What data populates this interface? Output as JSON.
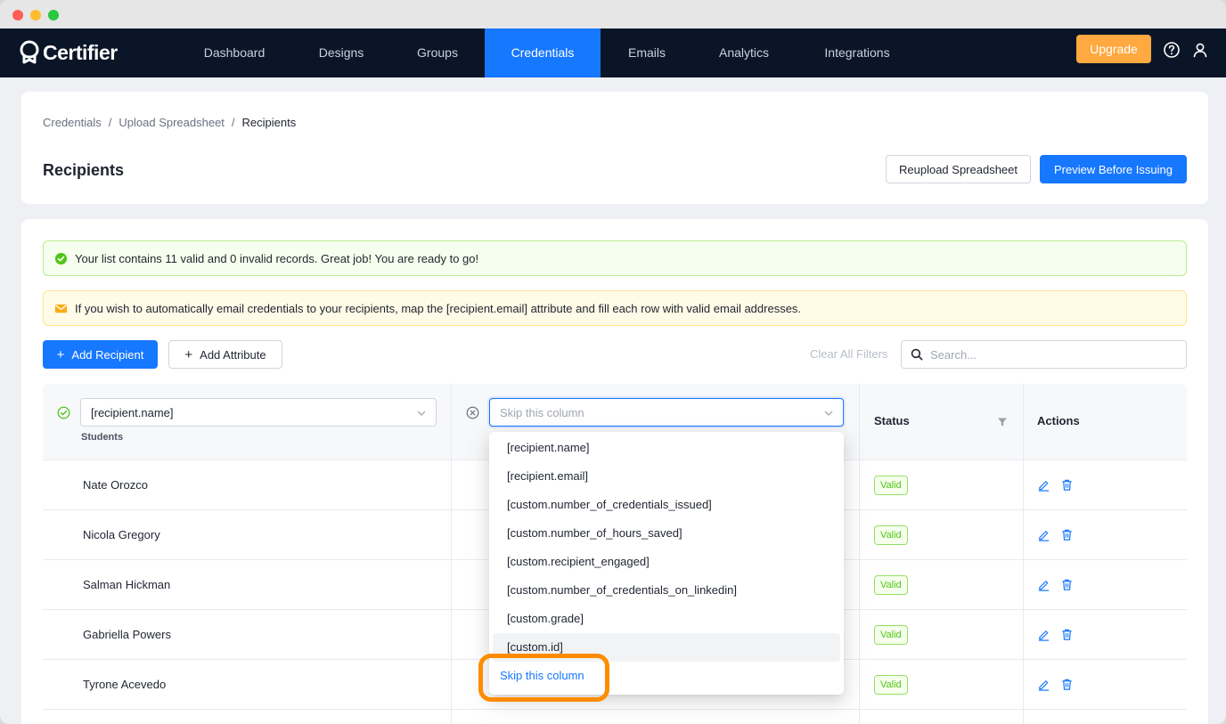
{
  "app": {
    "name": "Certifier",
    "nav": [
      {
        "label": "Dashboard"
      },
      {
        "label": "Designs"
      },
      {
        "label": "Groups"
      },
      {
        "label": "Credentials"
      },
      {
        "label": "Emails"
      },
      {
        "label": "Analytics"
      },
      {
        "label": "Integrations"
      }
    ],
    "active_nav": "Credentials",
    "upgrade_label": "Upgrade"
  },
  "header": {
    "breadcrumb": [
      "Credentials",
      "/",
      "Upload Spreadsheet",
      "/",
      "Recipients"
    ],
    "title": "Recipients",
    "reupload_label": "Reupload Spreadsheet",
    "preview_label": "Preview Before Issuing"
  },
  "alerts": {
    "success": "Your list contains 11 valid and 0 invalid records. Great job! You are ready to go!",
    "warning": "If you wish to automatically email credentials to your recipients, map the [recipient.email] attribute and fill each row with valid email addresses."
  },
  "toolbar": {
    "add_recipient_label": "Add Recipient",
    "add_attribute_label": "Add Attribute",
    "clear_filters_label": "Clear All Filters",
    "search_placeholder": "Search..."
  },
  "table": {
    "col1_select_value": "[recipient.name]",
    "col1_source": "Students",
    "col2_select_placeholder": "Skip this column",
    "status_header": "Status",
    "actions_header": "Actions",
    "rows": [
      {
        "name": "Nate Orozco",
        "status": "Valid"
      },
      {
        "name": "Nicola Gregory",
        "status": "Valid"
      },
      {
        "name": "Salman Hickman",
        "status": "Valid"
      },
      {
        "name": "Gabriella Powers",
        "status": "Valid"
      },
      {
        "name": "Tyrone Acevedo",
        "status": "Valid"
      }
    ]
  },
  "dropdown": {
    "options": [
      "[recipient.name]",
      "[recipient.email]",
      "[custom.number_of_credentials_issued]",
      "[custom.number_of_hours_saved]",
      "[custom.recipient_engaged]",
      "[custom.number_of_credentials_on_linkedin]",
      "[custom.grade]",
      "[custom.id]"
    ],
    "hovered_option": "[custom.id]",
    "skip_label": "Skip this column"
  },
  "colors": {
    "nav_bg": "#0a1628",
    "primary": "#1677ff",
    "upgrade": "#ffa940",
    "highlight": "#ff8c00",
    "valid_green": "#52c41a"
  }
}
